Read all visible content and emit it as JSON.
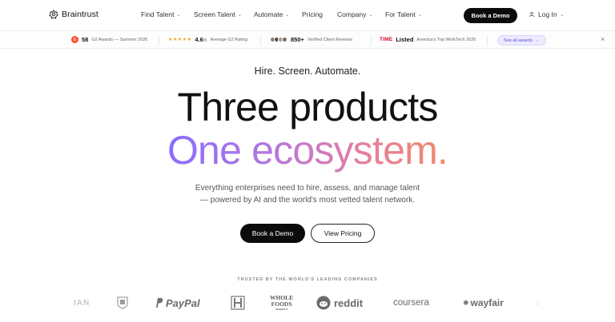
{
  "nav": {
    "logo_text": "Braintrust",
    "items": [
      {
        "label": "Find Talent",
        "has_dropdown": true
      },
      {
        "label": "Screen Talent",
        "has_dropdown": true
      },
      {
        "label": "Automate",
        "has_dropdown": true
      },
      {
        "label": "Pricing",
        "has_dropdown": false
      },
      {
        "label": "Company",
        "has_dropdown": true
      },
      {
        "label": "For Talent",
        "has_dropdown": true
      }
    ],
    "cta_label": "Book a Demo",
    "login_label": "Log In"
  },
  "awards_bar": {
    "g2": {
      "number": "58",
      "text": "G2 Awards — Summer 2026",
      "icon": "G"
    },
    "rating": {
      "stars": "★★★★★",
      "number": "4.6",
      "suffix": "/5",
      "text": "Average G2 Rating"
    },
    "reviews": {
      "number": "850+",
      "text": "Verified Client Reviews"
    },
    "time": {
      "logo": "TIME",
      "label": "Listed",
      "text": "America's Top WorkTech 2026"
    },
    "see_all_label": "See all awards",
    "close_icon": "×"
  },
  "hero": {
    "eyebrow": "Hire. Screen. Automate.",
    "headline_1": "Three products",
    "headline_2": "One ecosystem.",
    "sub_line_1": "Everything enterprises need to hire, assess, and manage talent",
    "sub_line_2": "— powered by AI and the world's most vetted talent network.",
    "primary_cta": "Book a Demo",
    "secondary_cta": "View Pricing"
  },
  "trusted": {
    "label": "TRUSTED BY THE WORLD'S LEADING COMPANIES",
    "logos": {
      "rivian": "IAN",
      "paypal": "PayPal",
      "whole_foods_line1": "WHOLE",
      "whole_foods_line2": "FOODS",
      "whole_foods_line3": "MARKET",
      "reddit": "reddit",
      "coursera": "coursera",
      "wayfair": "wayfair"
    }
  },
  "colors": {
    "brand_black": "#0b0b0b",
    "gradient_start": "#8a6cff",
    "gradient_end": "#f08a6a",
    "g2_red": "#ff492c",
    "time_red": "#e4002b",
    "pill_purple": "#5b4fd6"
  }
}
